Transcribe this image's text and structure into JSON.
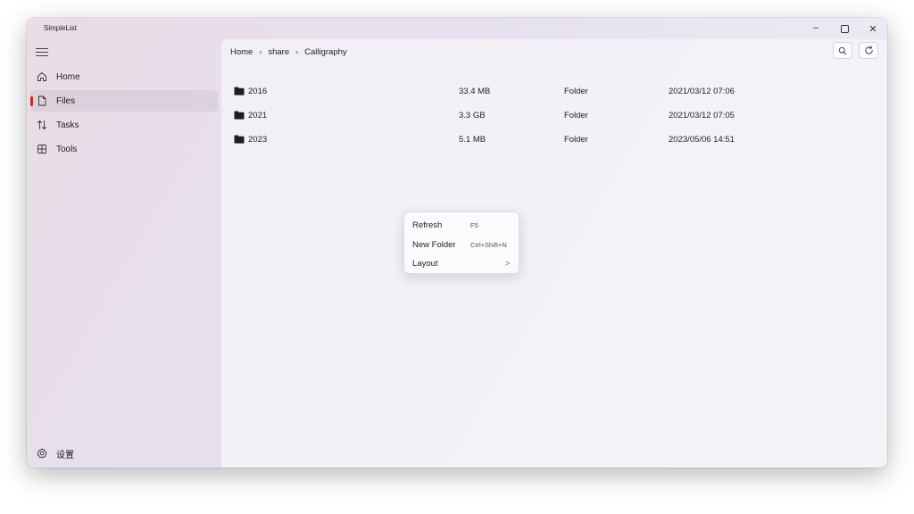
{
  "app": {
    "title": "SimpleList"
  },
  "window_controls": {
    "minimize": "−",
    "maximize": "☐",
    "close": "✕"
  },
  "sidebar": {
    "items": [
      {
        "label": "Home",
        "icon": "home-icon",
        "active": false
      },
      {
        "label": "Files",
        "icon": "file-icon",
        "active": true
      },
      {
        "label": "Tasks",
        "icon": "transfer-icon",
        "active": false
      },
      {
        "label": "Tools",
        "icon": "grid-icon",
        "active": false
      }
    ],
    "settings_label": "设置"
  },
  "breadcrumb": [
    "Home",
    "share",
    "Calligraphy"
  ],
  "files": [
    {
      "name": "2016",
      "size": "33.4 MB",
      "type": "Folder",
      "date": "2021/03/12 07:06"
    },
    {
      "name": "2021",
      "size": "3.3 GB",
      "type": "Folder",
      "date": "2021/03/12 07:05"
    },
    {
      "name": "2023",
      "size": "5.1 MB",
      "type": "Folder",
      "date": "2023/05/06 14:51"
    }
  ],
  "context_menu": {
    "items": [
      {
        "label": "Refresh",
        "shortcut": "F5"
      },
      {
        "label": "New Folder",
        "shortcut": "Ctrl+Shift+N"
      },
      {
        "label": "Layout",
        "shortcut": "",
        "submenu": ">"
      }
    ]
  },
  "colors": {
    "accent": "#c42b1c"
  }
}
